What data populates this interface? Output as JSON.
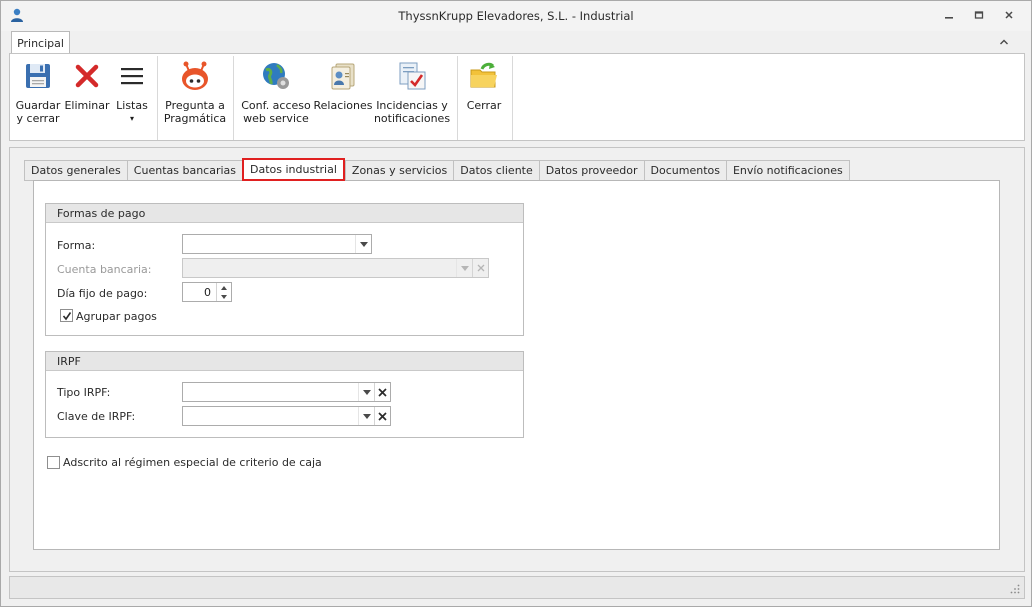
{
  "window": {
    "title": "ThyssnKrupp Elevadores, S.L. - Industrial",
    "app_icon": "user-icon",
    "controls": [
      "minimize-icon",
      "restore-icon",
      "close-icon"
    ]
  },
  "ribbon": {
    "tab_label": "Principal",
    "buttons": [
      {
        "id": "guardar",
        "label1": "Guardar",
        "label2": "y cerrar",
        "icon": "floppy-disk-icon"
      },
      {
        "id": "eliminar",
        "label1": "Eliminar",
        "label2": "",
        "icon": "red-x-icon"
      },
      {
        "id": "listas",
        "label1": "Listas",
        "label2": "▾",
        "icon": "list-icon"
      },
      {
        "id": "pregunta",
        "label1": "Pregunta a",
        "label2": "Pragmática",
        "icon": "robot-icon"
      },
      {
        "id": "conf",
        "label1": "Conf. acceso",
        "label2": "web service",
        "icon": "globe-gear-icon"
      },
      {
        "id": "relaciones",
        "label1": "Relaciones",
        "label2": "",
        "icon": "contacts-icon"
      },
      {
        "id": "incidencias",
        "label1": "Incidencias y",
        "label2": "notificaciones",
        "icon": "clipboard-check-icon"
      },
      {
        "id": "cerrar",
        "label1": "Cerrar",
        "label2": "",
        "icon": "folder-arrow-icon"
      }
    ]
  },
  "tabs": [
    {
      "label": "Datos generales",
      "active": false
    },
    {
      "label": "Cuentas bancarias",
      "active": false
    },
    {
      "label": "Datos industrial",
      "active": true
    },
    {
      "label": "Zonas y servicios",
      "active": false
    },
    {
      "label": "Datos cliente",
      "active": false
    },
    {
      "label": "Datos proveedor",
      "active": false
    },
    {
      "label": "Documentos",
      "active": false
    },
    {
      "label": "Envío notificaciones",
      "active": false
    }
  ],
  "formas_pago": {
    "title": "Formas de pago",
    "forma_label": "Forma:",
    "forma_value": "",
    "cuenta_label": "Cuenta bancaria:",
    "cuenta_value": "",
    "dia_label": "Día fijo de pago:",
    "dia_value": "0",
    "agrupar_label": "Agrupar pagos",
    "agrupar_checked": true
  },
  "irpf": {
    "title": "IRPF",
    "tipo_label": "Tipo IRPF:",
    "tipo_value": "",
    "clave_label": "Clave de IRPF:",
    "clave_value": ""
  },
  "adscrito": {
    "label": "Adscrito al régimen especial de criterio de caja",
    "checked": false
  },
  "colors": {
    "active_tab_border": "#e02020",
    "eliminar_icon": "#d42a2a",
    "pregunta_icon": "#e8552a"
  }
}
